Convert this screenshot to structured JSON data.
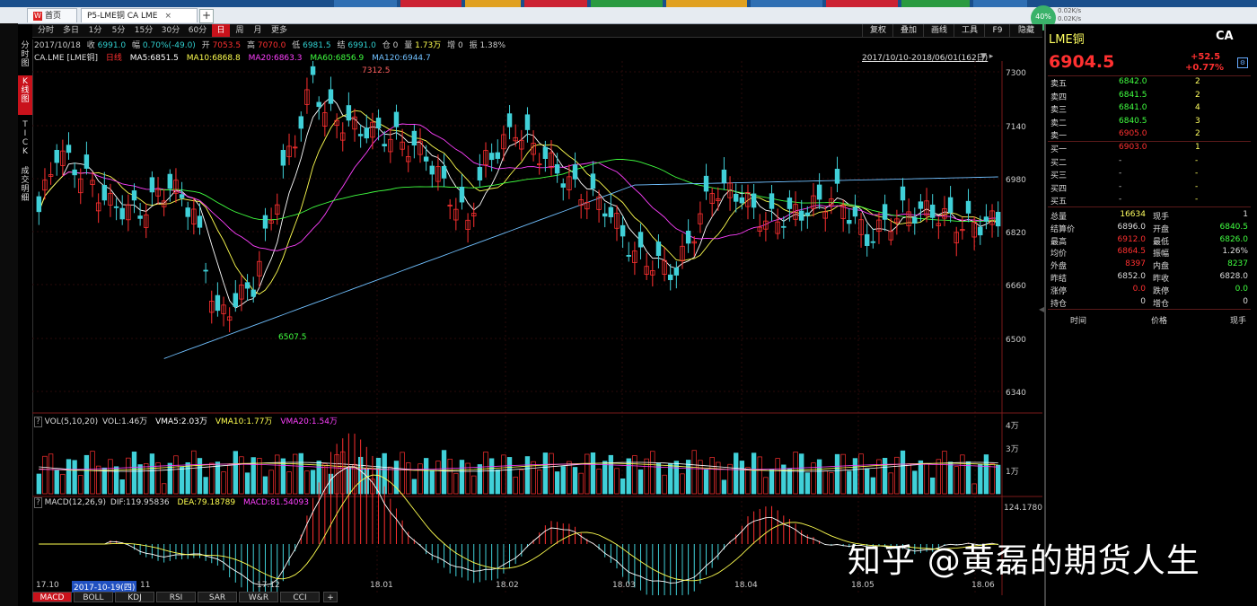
{
  "browser": {
    "tabs": [
      {
        "label": "首页",
        "icon": "W"
      },
      {
        "label": "P5-LME铜 CA LME",
        "close": "×"
      }
    ],
    "add_tab": "+",
    "network": {
      "percent": "40%",
      "up": "0.02K/s",
      "down": "0.02K/s"
    }
  },
  "left_nav": [
    {
      "label": "分时图",
      "active": false
    },
    {
      "label": "K线图",
      "active": true
    },
    {
      "label": "TICK",
      "active": false
    },
    {
      "label": "成交明细",
      "active": false
    }
  ],
  "period_bar": {
    "periods": [
      "分时",
      "多日",
      "1分",
      "5分",
      "15分",
      "30分",
      "60分",
      "日",
      "周",
      "月",
      "更多"
    ],
    "active": "日",
    "tools": [
      "复权",
      "叠加",
      "画线",
      "工具",
      "F9",
      "隐藏"
    ]
  },
  "info_line": {
    "date": "2017/10/18",
    "shou_label": "收",
    "shou": "6991.0",
    "fu_label": "幅",
    "fu": "0.70%(-49.0)",
    "kai_label": "开",
    "kai": "7053.5",
    "gao_label": "高",
    "gao": "7070.0",
    "di_label": "低",
    "di": "6981.5",
    "jie_label": "结",
    "jie": "6991.0",
    "cang_label": "仓",
    "cang": "0",
    "liang_label": "量",
    "liang": "1.73万",
    "zeng_label": "增",
    "zeng": "0",
    "zhen_label": "振",
    "zhen": "1.38%"
  },
  "ma_line": {
    "symbol": "CA.LME [LME铜]",
    "period": "日线",
    "ma5": "MA5:6851.5",
    "ma10": "MA10:6868.8",
    "ma20": "MA20:6863.3",
    "ma60": "MA60:6856.9",
    "ma120": "MA120:6944.7",
    "range": "2017/10/10-2018/06/01(162日)"
  },
  "chart": {
    "y_ticks": [
      "7300",
      "7140",
      "6980",
      "6820",
      "6660",
      "6500",
      "6340"
    ],
    "max_label": "7312.5",
    "min_label": "6507.5",
    "vol_header": {
      "name": "VOL(5,10,20)",
      "vol": "VOL:1.46万",
      "vma5": "VMA5:2.03万",
      "vma10": "VMA10:1.77万",
      "vma20": "VMA20:1.54万"
    },
    "vol_ticks": [
      "4万",
      "3万",
      "1万"
    ],
    "macd_header": {
      "name": "MACD(12,26,9)",
      "dif": "DIF:119.95836",
      "dea": "DEA:79.18789",
      "macd": "MACD:81.54093"
    },
    "macd_tick": "124.1780",
    "x_labels": [
      "17.10",
      "11",
      "17.12",
      "18.01",
      "18.02",
      "18.03",
      "18.04",
      "18.05",
      "18.06"
    ],
    "cursor_date": "2017-10-19(四)",
    "colors": {
      "up": "#ff3030",
      "down": "#40d0d8",
      "ma5": "#ffffff",
      "ma10": "#ffff50",
      "ma20": "#ff40ff",
      "ma60": "#40ff40",
      "ma120": "#70c0ff"
    }
  },
  "bottom_tabs": [
    "MACD",
    "BOLL",
    "KDJ",
    "RSI",
    "SAR",
    "W&R",
    "CCI",
    "+"
  ],
  "quote": {
    "name": "LME铜",
    "code": "CA",
    "price": "6904.5",
    "change": "+52.5",
    "change_pct": "+0.77%",
    "sell": [
      {
        "label": "卖五",
        "price": "6842.0",
        "vol": "2"
      },
      {
        "label": "卖四",
        "price": "6841.5",
        "vol": "2"
      },
      {
        "label": "卖三",
        "price": "6841.0",
        "vol": "4"
      },
      {
        "label": "卖二",
        "price": "6840.5",
        "vol": "3"
      },
      {
        "label": "卖一",
        "price": "6905.0",
        "vol": "2"
      }
    ],
    "buy": [
      {
        "label": "买一",
        "price": "6903.0",
        "vol": "1"
      },
      {
        "label": "买二",
        "price": "-",
        "vol": "-"
      },
      {
        "label": "买三",
        "price": "-",
        "vol": "-"
      },
      {
        "label": "买四",
        "price": "-",
        "vol": "-"
      },
      {
        "label": "买五",
        "price": "-",
        "vol": "-"
      }
    ],
    "stats": [
      {
        "l1": "总量",
        "v1": "16634",
        "l2": "现手",
        "v2": "1"
      },
      {
        "l1": "结算价",
        "v1": "6896.0",
        "l2": "开盘",
        "v2": "6840.5"
      },
      {
        "l1": "最高",
        "v1": "6912.0",
        "l2": "最低",
        "v2": "6826.0"
      },
      {
        "l1": "均价",
        "v1": "6864.5",
        "l2": "振幅",
        "v2": "1.26%"
      },
      {
        "l1": "外盘",
        "v1": "8397",
        "l2": "内盘",
        "v2": "8237"
      },
      {
        "l1": "昨结",
        "v1": "6852.0",
        "l2": "昨收",
        "v2": "6828.0"
      },
      {
        "l1": "涨停",
        "v1": "0.0",
        "l2": "跌停",
        "v2": "0.0"
      },
      {
        "l1": "持仓",
        "v1": "0",
        "l2": "增仓",
        "v2": "0"
      }
    ],
    "tick_headers": [
      "时间",
      "价格",
      "现手"
    ]
  },
  "watermark": "知乎 @黄磊的期货人生"
}
